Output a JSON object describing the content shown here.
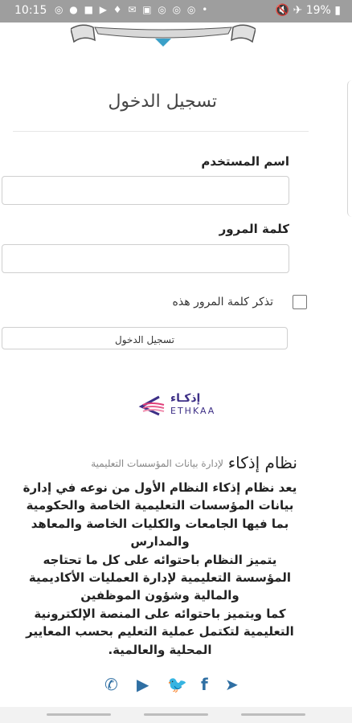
{
  "status_bar": {
    "time": "10:15",
    "notification_icons": "◎ ● ■ ▶ ♦ ✉ ▣ ◎ ◎ ◎ •",
    "right": "🔇 ✈ 19% ▮"
  },
  "page": {
    "title": "تسجيل الدخول",
    "username_label": "اسم المستخدم",
    "password_label": "كلمة المرور",
    "remember_label": "تذكر كلمة المرور هذه",
    "login_button": "تسجيل الدخول"
  },
  "logo": {
    "ar": "إذكـاء",
    "en": "ETHKAA",
    "color": "#3d2f86"
  },
  "brand": {
    "title": "نظام إذكاء",
    "subtitle": "لإدارة بيانات المؤسسات التعليمية"
  },
  "description": [
    "يعد نظام إذكاء النظام الأول من نوعه في إدارة بيانات المؤسسات التعليمية الخاصة والحكومية بما فيها الجامعات والكليات الخاصة والمعاهد والمدارس",
    "يتميز النظام باحتوائه على كل ما تحتاجه المؤسسة التعليمية لإدارة العمليات الأكاديمية والمالية وشؤون الموظفين",
    "كما ويتميز باحتوائه على المنصة الإلكترونية التعليمية لتكتمل عملية التعليم بحسب المعايير المحلية والعالمية."
  ],
  "social": {
    "whatsapp": "✆",
    "youtube": "▶",
    "twitter": "🐦",
    "facebook": "f",
    "telegram": "➤",
    "color": "#2f6fa3"
  }
}
